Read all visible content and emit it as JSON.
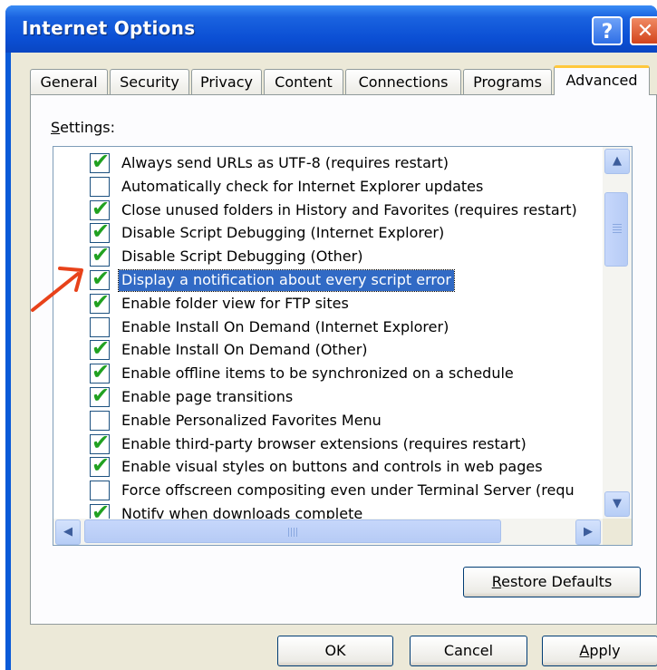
{
  "window": {
    "title": "Internet Options",
    "help_glyph": "?",
    "close_glyph": "✕"
  },
  "tabs": [
    {
      "label": "General"
    },
    {
      "label": "Security"
    },
    {
      "label": "Privacy"
    },
    {
      "label": "Content"
    },
    {
      "label": "Connections"
    },
    {
      "label": "Programs"
    },
    {
      "label": "Advanced",
      "active": true
    }
  ],
  "settings": {
    "label_accel": "S",
    "label_rest": "ettings:",
    "items": [
      {
        "label": "Always send URLs as UTF-8 (requires restart)",
        "checked": true
      },
      {
        "label": "Automatically check for Internet Explorer updates",
        "checked": false
      },
      {
        "label": "Close unused folders in History and Favorites (requires restart)",
        "checked": true
      },
      {
        "label": "Disable Script Debugging (Internet Explorer)",
        "checked": true
      },
      {
        "label": "Disable Script Debugging (Other)",
        "checked": true
      },
      {
        "label": "Display a notification about every script error",
        "checked": true,
        "selected": true
      },
      {
        "label": "Enable folder view for FTP sites",
        "checked": true
      },
      {
        "label": "Enable Install On Demand (Internet Explorer)",
        "checked": false
      },
      {
        "label": "Enable Install On Demand (Other)",
        "checked": true
      },
      {
        "label": "Enable offline items to be synchronized on a schedule",
        "checked": true
      },
      {
        "label": "Enable page transitions",
        "checked": true
      },
      {
        "label": "Enable Personalized Favorites Menu",
        "checked": false
      },
      {
        "label": "Enable third-party browser extensions (requires restart)",
        "checked": true
      },
      {
        "label": "Enable visual styles on buttons and controls in web pages",
        "checked": true
      },
      {
        "label": "Force offscreen compositing even under Terminal Server (requ",
        "checked": false
      },
      {
        "label": "Notify when downloads complete",
        "checked": true
      }
    ]
  },
  "icons": {
    "check": "✔",
    "scroll_up": "▲",
    "scroll_down": "▼",
    "scroll_left": "◀",
    "scroll_right": "▶"
  },
  "buttons": {
    "restore_accel": "R",
    "restore_rest": "estore Defaults",
    "ok": "OK",
    "cancel": "Cancel",
    "apply_accel": "A",
    "apply_rest": "pply"
  },
  "colors": {
    "title_bar": "#0b4fd4",
    "selection": "#316ac5",
    "check": "#21a121",
    "annotation_arrow": "#e8421a"
  }
}
